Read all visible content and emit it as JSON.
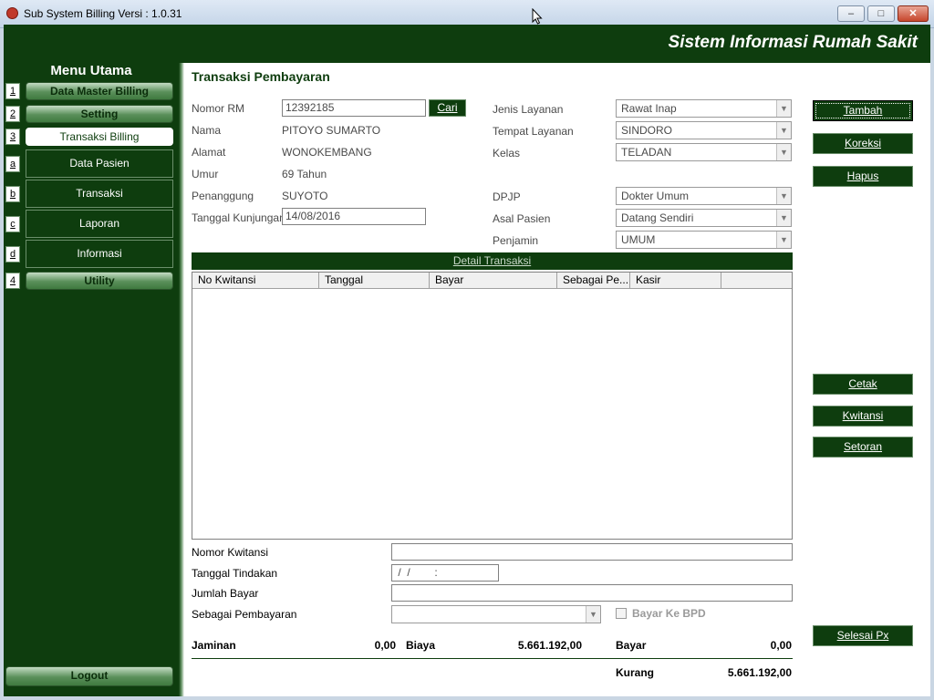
{
  "window": {
    "title": "Sub System Billing Versi : 1.0.31",
    "minimize": "–",
    "maximize": "□",
    "close": "✕"
  },
  "header": {
    "title": "Sistem Informasi Rumah Sakit"
  },
  "sidebar": {
    "title": "Menu Utama",
    "items": [
      {
        "num": "1",
        "label": "Data Master Billing"
      },
      {
        "num": "2",
        "label": "Setting"
      },
      {
        "num": "3",
        "label": "Transaksi Billing"
      },
      {
        "num": "a",
        "label": "Data Pasien"
      },
      {
        "num": "b",
        "label": "Transaksi"
      },
      {
        "num": "c",
        "label": "Laporan"
      },
      {
        "num": "d",
        "label": "Informasi"
      },
      {
        "num": "4",
        "label": "Utility"
      }
    ],
    "logout": "Logout"
  },
  "form": {
    "title": "Transaksi Pembayaran",
    "nomor_rm": {
      "label": "Nomor RM",
      "value": "12392185"
    },
    "cari": "Cari",
    "nama": {
      "label": "Nama",
      "value": "PITOYO SUMARTO"
    },
    "alamat": {
      "label": "Alamat",
      "value": "WONOKEMBANG"
    },
    "umur": {
      "label": "Umur",
      "value": "69 Tahun"
    },
    "penanggung": {
      "label": "Penanggung",
      "value": "SUYOTO"
    },
    "tanggal_kunjungan": {
      "label": "Tanggal Kunjungan",
      "value": "14/08/2016"
    },
    "jenis_layanan": {
      "label": "Jenis Layanan",
      "value": "Rawat Inap"
    },
    "tempat_layanan": {
      "label": "Tempat Layanan",
      "value": "SINDORO"
    },
    "kelas": {
      "label": "Kelas",
      "value": "TELADAN"
    },
    "dpjp": {
      "label": "DPJP",
      "value": "Dokter Umum"
    },
    "asal_pasien": {
      "label": "Asal Pasien",
      "value": "Datang Sendiri"
    },
    "penjamin": {
      "label": "Penjamin",
      "value": "UMUM"
    }
  },
  "detail": {
    "title": "Detail Transaksi",
    "columns": [
      "No Kwitansi",
      "Tanggal",
      "Bayar",
      "Sebagai Pe...",
      "Kasir"
    ]
  },
  "payment": {
    "nomor_kwitansi": {
      "label": "Nomor Kwitansi",
      "value": ""
    },
    "tanggal_tindakan": {
      "label": "Tanggal Tindakan",
      "value": " /  /        :"
    },
    "jumlah_bayar": {
      "label": "Jumlah Bayar",
      "value": ""
    },
    "sebagai_pembayaran": {
      "label": "Sebagai Pembayaran",
      "value": ""
    },
    "bayar_ke_bpd": "Bayar Ke BPD"
  },
  "totals": {
    "jaminan_label": "Jaminan",
    "jaminan_value": "0,00",
    "biaya_label": "Biaya",
    "biaya_value": "5.661.192,00",
    "bayar_label": "Bayar",
    "bayar_value": "0,00",
    "kurang_label": "Kurang",
    "kurang_value": "5.661.192,00"
  },
  "actions": {
    "tambah": "Tambah",
    "koreksi": "Koreksi",
    "hapus": "Hapus",
    "cetak": "Cetak",
    "kwitansi": "Kwitansi",
    "setoran": "Setoran",
    "selesai": "Selesai Px"
  }
}
